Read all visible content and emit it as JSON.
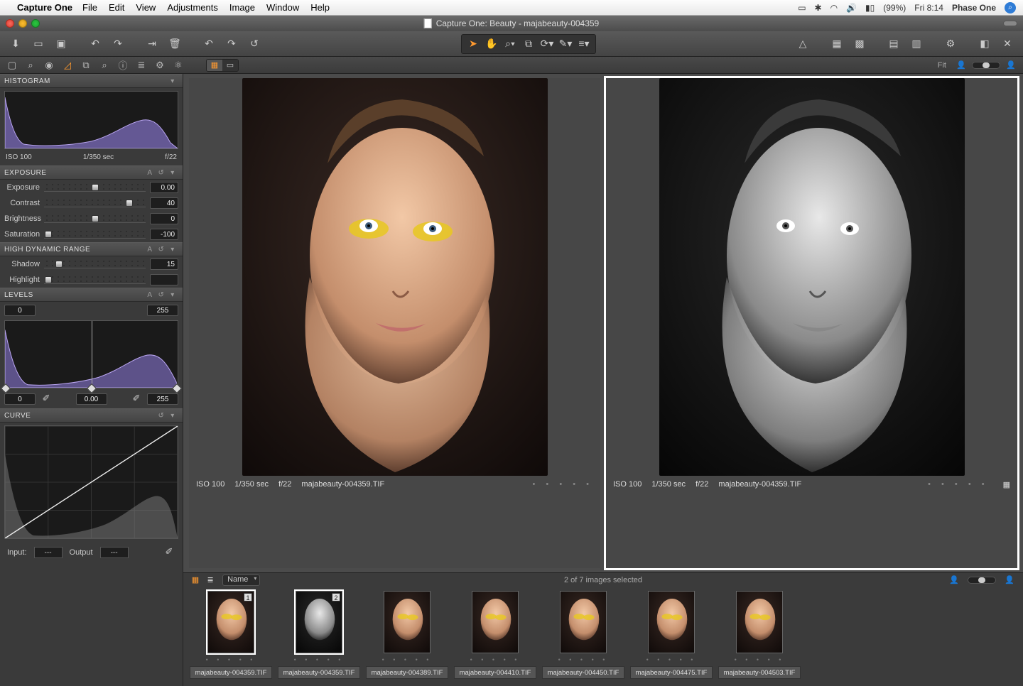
{
  "menubar": {
    "app": "Capture One",
    "items": [
      "File",
      "Edit",
      "View",
      "Adjustments",
      "Image",
      "Window",
      "Help"
    ],
    "battery": "(99%)",
    "clock": "Fri 8:14",
    "brand": "Phase One"
  },
  "window": {
    "title": "Capture One: Beauty - majabeauty-004359"
  },
  "tabstrip": {
    "fit": "Fit"
  },
  "histogram": {
    "title": "HISTOGRAM",
    "iso": "ISO 100",
    "shutter": "1/350 sec",
    "aperture": "f/22"
  },
  "exposure": {
    "title": "EXPOSURE",
    "auto": "A",
    "rows": [
      {
        "label": "Exposure",
        "value": "0.00",
        "pos": 50
      },
      {
        "label": "Contrast",
        "value": "40",
        "pos": 84
      },
      {
        "label": "Brightness",
        "value": "0",
        "pos": 50
      },
      {
        "label": "Saturation",
        "value": "-100",
        "pos": 4
      }
    ]
  },
  "hdr": {
    "title": "HIGH DYNAMIC RANGE",
    "auto": "A",
    "rows": [
      {
        "label": "Shadow",
        "value": "15",
        "pos": 15
      },
      {
        "label": "Highlight",
        "value": "",
        "pos": 4
      }
    ]
  },
  "levels": {
    "title": "LEVELS",
    "auto": "A",
    "lo": "0",
    "hi": "255",
    "lo2": "0",
    "mid": "0.00",
    "hi2": "255"
  },
  "curve": {
    "title": "CURVE",
    "input": "Input:",
    "output": "Output",
    "in_v": "---",
    "out_v": "---"
  },
  "viewer": {
    "left": {
      "iso": "ISO 100",
      "shutter": "1/350 sec",
      "aperture": "f/22",
      "file": "majabeauty-004359.TIF"
    },
    "right": {
      "iso": "ISO 100",
      "shutter": "1/350 sec",
      "aperture": "f/22",
      "file": "majabeauty-004359.TIF"
    }
  },
  "browser": {
    "sort": "Name",
    "status": "2 of 7 images selected",
    "thumbs": [
      {
        "name": "majabeauty-004359.TIF",
        "selected": true,
        "badge": "1",
        "bw": false
      },
      {
        "name": "majabeauty-004359.TIF",
        "selected": true,
        "badge": "2",
        "bw": true
      },
      {
        "name": "majabeauty-004389.TIF",
        "selected": false,
        "badge": "",
        "bw": false
      },
      {
        "name": "majabeauty-004410.TIF",
        "selected": false,
        "badge": "",
        "bw": false
      },
      {
        "name": "majabeauty-004450.TIF",
        "selected": false,
        "badge": "",
        "bw": false
      },
      {
        "name": "majabeauty-004475.TIF",
        "selected": false,
        "badge": "",
        "bw": false
      },
      {
        "name": "majabeauty-004503.TIF",
        "selected": false,
        "badge": "",
        "bw": false
      }
    ]
  }
}
